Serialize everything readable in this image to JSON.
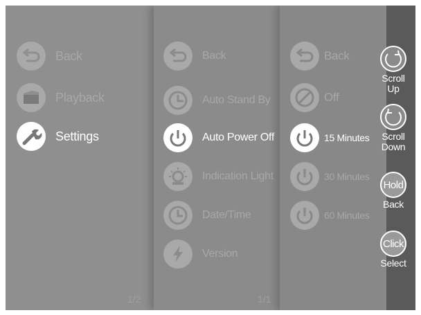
{
  "panel1": {
    "items": [
      {
        "label": "Back",
        "icon": "back-arrow-icon"
      },
      {
        "label": "Playback",
        "icon": "folder-icon"
      },
      {
        "label": "Settings",
        "icon": "wrench-icon"
      }
    ],
    "page": "1/2"
  },
  "panel2": {
    "items": [
      {
        "label": "Back",
        "icon": "back-arrow-icon"
      },
      {
        "label": "Auto Stand By",
        "icon": "clock-icon"
      },
      {
        "label": "Auto Power Off",
        "icon": "power-icon"
      },
      {
        "label": "Indication Light",
        "icon": "light-icon"
      },
      {
        "label": "Date/Time",
        "icon": "clock-icon"
      },
      {
        "label": "Version",
        "icon": "lightning-icon"
      }
    ],
    "page": "1/1"
  },
  "panel3": {
    "items": [
      {
        "label": "Back",
        "icon": "back-arrow-icon"
      },
      {
        "label": "Off",
        "icon": "off-slash-icon"
      },
      {
        "label": "15 Minutes",
        "icon": "power-icon"
      },
      {
        "label": "30 Minutes",
        "icon": "power-icon"
      },
      {
        "label": "60 Minutes",
        "icon": "power-icon"
      }
    ]
  },
  "controls": {
    "scroll_up": "Scroll\nUp",
    "scroll_down": "Scroll\nDown",
    "hold": "Hold",
    "back": "Back",
    "click": "Click",
    "select": "Select"
  },
  "colors": {
    "active": "#ffffff",
    "dim": "#a9a9a9",
    "sidebar": "#5a5a5a"
  }
}
